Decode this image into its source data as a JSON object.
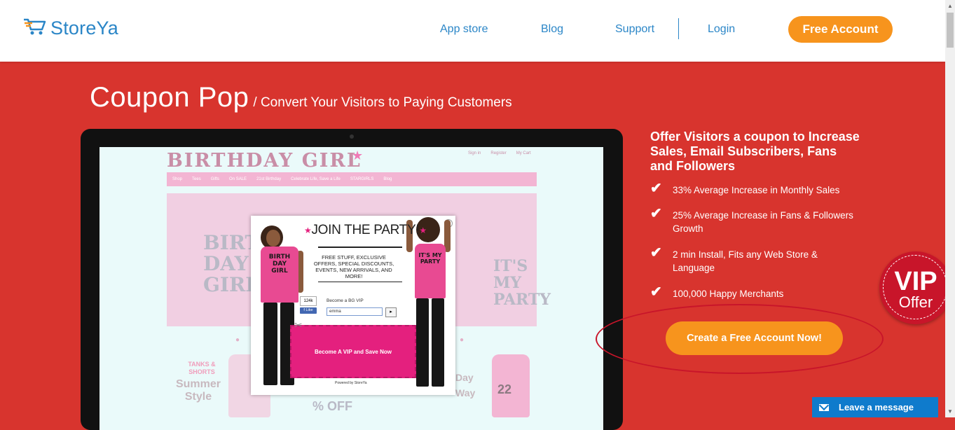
{
  "header": {
    "logo_text": "StoreYa",
    "nav": [
      "App store",
      "Blog",
      "Support",
      "Login"
    ],
    "cta_label": "Free Account"
  },
  "page": {
    "title_main": "Coupon Pop",
    "title_sub": "/ Convert Your Visitors to Paying Customers"
  },
  "preview": {
    "store_name": "BIRTHDAY GIRL",
    "top_links": [
      "Sign in",
      "Register",
      "My Cart"
    ],
    "menu": [
      "Shop",
      "Tees",
      "Gifts",
      "On SALE",
      "21st Birthday",
      "Celebrate Life, Save a Life",
      "STARGIRLS",
      "Blog"
    ],
    "shirt_text_left": "BIRTH DAY GIRL",
    "shirt_text_right": "IT'S MY PARTY",
    "tanks": "TANKS & SHORTS",
    "summer": "Summer Style",
    "off": "% OFF",
    "day_way": "Day Way",
    "number": "22"
  },
  "popup": {
    "title": "JOIN THE PARTY!",
    "description": "FREE STUFF, EXCLUSIVE OFFERS, SPECIAL DISCOUNTS, EVENTS, NEW ARRIVALS, AND MORE!",
    "vip_label": "Become a BG VIP",
    "input_value": "emma",
    "like_count": "124k",
    "like_label": "Like",
    "cta": "Become A VIP and Save Now",
    "powered": "Powered by StoreYa",
    "girl_left_shirt": "BIRTH DAY GIRL",
    "girl_right_shirt": "IT'S MY PARTY"
  },
  "offer": {
    "headline": "Offer Visitors a coupon to Increase Sales, Email Subscribers, Fans and Followers",
    "features": [
      "33% Average Increase in Monthly Sales",
      "25% Average Increase in Fans & Followers Growth",
      "2 min Install, Fits any Web Store & Language",
      "100,000 Happy Merchants"
    ],
    "cta": "Create a Free Account Now!"
  },
  "badge": {
    "big": "VIP",
    "small": "Offer"
  },
  "chat": {
    "label": "Leave a message"
  },
  "colors": {
    "brand_red": "#d8342e",
    "orange": "#f7941d",
    "brand_blue": "#2b86c7",
    "popup_pink": "#e4207e"
  }
}
